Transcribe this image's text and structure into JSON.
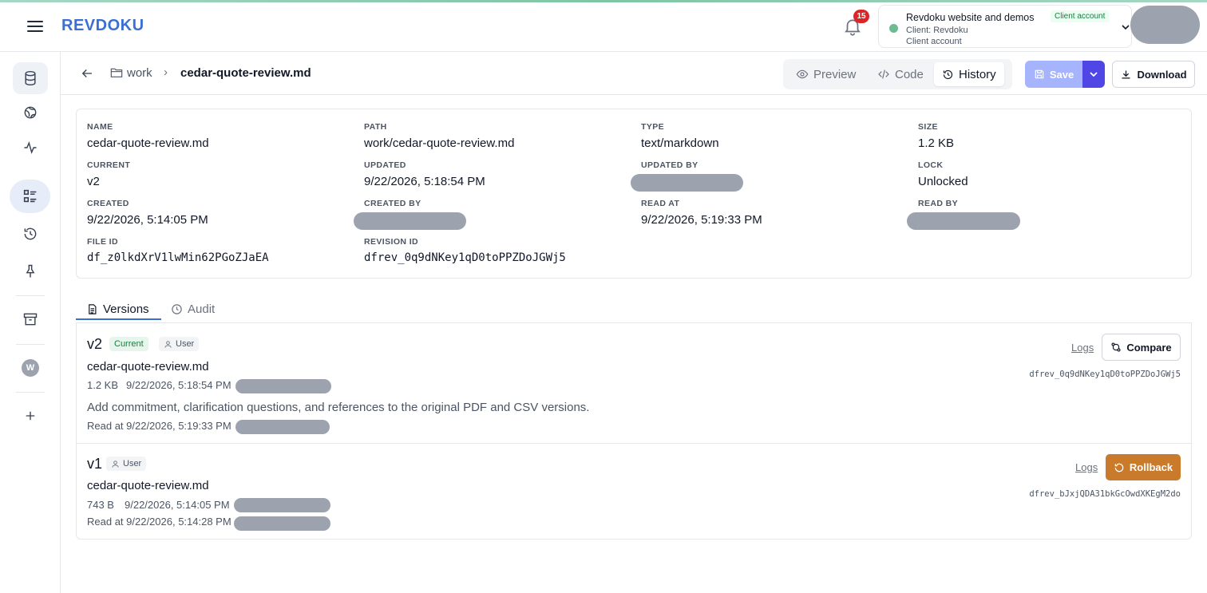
{
  "header": {
    "brand": "REVDOKU",
    "notification_count": "15",
    "account": {
      "name": "Revdoku website and demos",
      "tag": "Client account",
      "client_line": "Client: Revdoku",
      "type_line": "Client account"
    }
  },
  "breadcrumb": {
    "folder": "work",
    "separator": "›",
    "file": "cedar-quote-review.md"
  },
  "view_tabs": {
    "preview": "Preview",
    "code": "Code",
    "history": "History"
  },
  "actions": {
    "save": "Save",
    "download": "Download"
  },
  "meta": {
    "name_label": "NAME",
    "name": "cedar-quote-review.md",
    "path_label": "PATH",
    "path": "work/cedar-quote-review.md",
    "type_label": "TYPE",
    "type": "text/markdown",
    "size_label": "SIZE",
    "size": "1.2 KB",
    "current_label": "CURRENT",
    "current": "v2",
    "updated_label": "UPDATED",
    "updated": "9/22/2026, 5:18:54 PM",
    "updated_by_label": "UPDATED BY",
    "lock_label": "LOCK",
    "lock": "Unlocked",
    "created_label": "CREATED",
    "created": "9/22/2026, 5:14:05 PM",
    "created_by_label": "CREATED BY",
    "read_at_label": "READ AT",
    "read_at": "9/22/2026, 5:19:33 PM",
    "read_by_label": "READ BY",
    "file_id_label": "FILE ID",
    "file_id": "df_z0lkdXrV1lwMin62PGoZJaEA",
    "revision_id_label": "REVISION ID",
    "revision_id": "dfrev_0q9dNKey1qD0toPPZDoJGWj5"
  },
  "tabs": {
    "versions": "Versions",
    "audit": "Audit"
  },
  "versions": [
    {
      "version": "v2",
      "current_badge": "Current",
      "author_badge": "User",
      "file": "cedar-quote-review.md",
      "size": "1.2 KB",
      "date": "9/22/2026, 5:18:54 PM",
      "description": "Add commitment, clarification questions, and references to the original PDF and CSV versions.",
      "read_at": "Read at 9/22/2026, 5:19:33 PM",
      "logs": "Logs",
      "action": "Compare",
      "revision_id": "dfrev_0q9dNKey1qD0toPPZDoJGWj5"
    },
    {
      "version": "v1",
      "author_badge": "User",
      "file": "cedar-quote-review.md",
      "size": "743 B",
      "date": "9/22/2026, 5:14:05 PM",
      "read_at": "Read at 9/22/2026, 5:14:28 PM",
      "logs": "Logs",
      "action": "Rollback",
      "revision_id": "dfrev_bJxjQDA31bkGcOwdXKEgM2do"
    }
  ],
  "colors": {
    "brand": "#3b6fd1",
    "primary": "#4f46e5",
    "rollback": "#c97a2a",
    "current_badge": "#15803d",
    "notification": "#dc2626"
  },
  "sidebar_icons": [
    "database-icon",
    "globe-icon",
    "activity-icon",
    "list-icon",
    "history-icon",
    "pin-icon",
    "archive-icon",
    "workspace-w-badge",
    "plus-icon"
  ]
}
